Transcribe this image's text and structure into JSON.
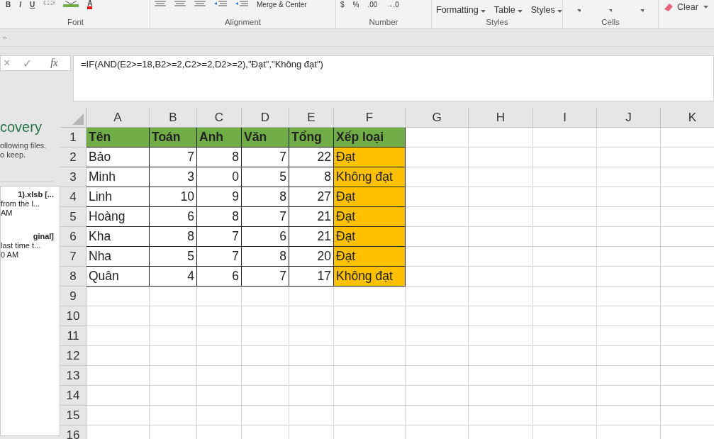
{
  "ribbon": {
    "groups": [
      {
        "label": "Font",
        "items": [
          {
            "kind": "bold",
            "text": "B"
          },
          {
            "kind": "italic",
            "text": "I"
          },
          {
            "kind": "underline",
            "text": "U"
          },
          {
            "kind": "borders"
          },
          {
            "kind": "fill"
          },
          {
            "kind": "fontcolor",
            "text": "A"
          }
        ]
      },
      {
        "label": "Alignment",
        "items": [
          {
            "kind": "align"
          },
          {
            "kind": "align"
          },
          {
            "kind": "align"
          },
          {
            "kind": "indent"
          },
          {
            "kind": "indent"
          },
          {
            "kind": "text",
            "text": "Merge & Center"
          }
        ]
      },
      {
        "label": "Number",
        "items": [
          {
            "kind": "text",
            "text": "$"
          },
          {
            "kind": "text",
            "text": "%"
          },
          {
            "kind": "text",
            "text": ".00"
          },
          {
            "kind": "text",
            "text": "→.0"
          }
        ]
      },
      {
        "label": "Styles",
        "items": [
          {
            "kind": "dropdown",
            "text": "Formatting"
          },
          {
            "kind": "dropdown",
            "text": "Table"
          },
          {
            "kind": "dropdown",
            "text": "Styles"
          }
        ]
      },
      {
        "label": "Cells",
        "items": [
          {
            "kind": "dropdown"
          },
          {
            "kind": "dropdown"
          },
          {
            "kind": "dropdown"
          }
        ]
      },
      {
        "items": [
          {
            "kind": "clear",
            "text": "Clear"
          }
        ]
      }
    ]
  },
  "formula_bar": {
    "cancel": "×",
    "enter": "✓",
    "fx": "fx",
    "formula": "=IF(AND(E2>=18,B2>=2,C2>=2,D2>=2),\"Đạt\",\"Không đạt\")"
  },
  "recovery_pane": {
    "title": "covery",
    "description": [
      "ollowing files.",
      "o keep."
    ],
    "files": [
      {
        "name": "1).xlsb  [...",
        "lines": [
          "from the l...",
          "AM"
        ]
      },
      {
        "name": "ginal]",
        "lines": [
          "last time t...",
          "0 AM"
        ]
      }
    ]
  },
  "sheet": {
    "columns": [
      "A",
      "B",
      "C",
      "D",
      "E",
      "F",
      "G",
      "H",
      "I",
      "J",
      "K"
    ],
    "row_numbers": [
      "1",
      "2",
      "3",
      "4",
      "5",
      "6",
      "7",
      "8",
      "9",
      "10",
      "11",
      "12",
      "13",
      "14",
      "15",
      "16"
    ],
    "header": [
      "Tên",
      "Toán",
      "Anh",
      "Văn",
      "Tổng",
      "Xếp loại"
    ],
    "rows": [
      [
        "Bảo",
        "7",
        "8",
        "7",
        "22",
        "Đạt"
      ],
      [
        "Minh",
        "3",
        "0",
        "5",
        "8",
        "Không đạt"
      ],
      [
        "Linh",
        "10",
        "9",
        "8",
        "27",
        "Đạt"
      ],
      [
        "Hoàng",
        "6",
        "8",
        "7",
        "21",
        "Đạt"
      ],
      [
        "Kha",
        "8",
        "7",
        "6",
        "21",
        "Đạt"
      ],
      [
        "Nha",
        "5",
        "7",
        "8",
        "20",
        "Đạt"
      ],
      [
        "Quân",
        "4",
        "6",
        "7",
        "17",
        "Không đạt"
      ]
    ]
  }
}
